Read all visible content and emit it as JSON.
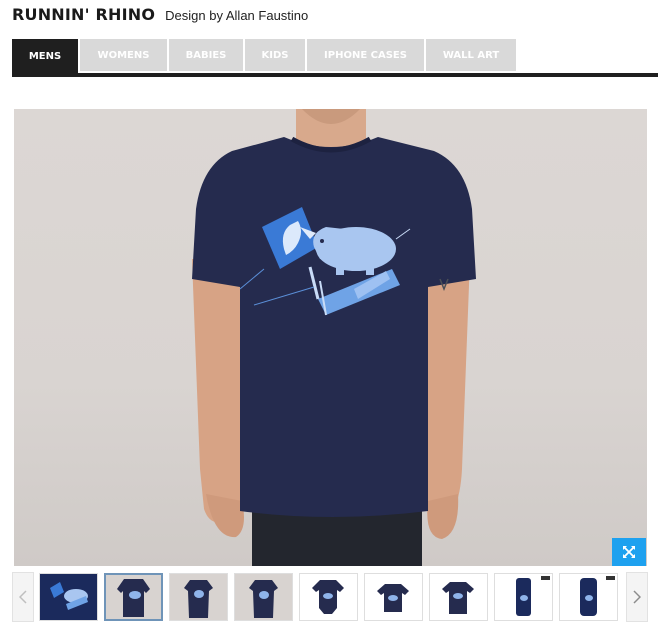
{
  "header": {
    "title": "RUNNIN' RHINO",
    "designer": "Design by Allan Faustino"
  },
  "tabs": [
    {
      "label": "MENS",
      "active": true
    },
    {
      "label": "WOMENS",
      "active": false
    },
    {
      "label": "BABIES",
      "active": false
    },
    {
      "label": "KIDS",
      "active": false
    },
    {
      "label": "IPHONE CASES",
      "active": false
    },
    {
      "label": "WALL ART",
      "active": false
    }
  ],
  "colors": {
    "tab_active": "#1f1f1f",
    "tab_inactive": "#d9d9d9",
    "accent": "#1ea1ef",
    "shirt": "#252b4e",
    "print": "#6fa3e6"
  },
  "gallery": {
    "expand_icon": "expand-arrows-icon",
    "prev_icon": "chevron-left-icon",
    "next_icon": "chevron-right-icon",
    "thumbnails": [
      {
        "name": "artwork",
        "selected": false
      },
      {
        "name": "mens-tee",
        "selected": true
      },
      {
        "name": "womens-tee-front",
        "selected": false
      },
      {
        "name": "womens-tee",
        "selected": false
      },
      {
        "name": "baby-onesie",
        "selected": false
      },
      {
        "name": "baby-tee",
        "selected": false
      },
      {
        "name": "kids-tee",
        "selected": false
      },
      {
        "name": "iphone-case-slim",
        "selected": false
      },
      {
        "name": "iphone-case",
        "selected": false
      }
    ]
  }
}
